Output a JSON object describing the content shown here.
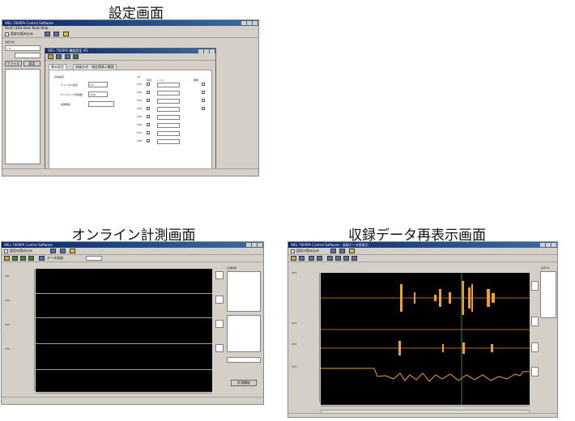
{
  "captions": {
    "settings": "設定画面",
    "online": "オンライン計測画面",
    "playback": "収録データ再表示画面"
  },
  "settings_window": {
    "app_title": "WEL-7000PA Control Software",
    "menu": "File(F)   Edit   View   Tools   Help",
    "toolbar_label": "設定の読み込み",
    "left_label": "測定方式",
    "left_value": "1 ch",
    "left_buttons": [
      "ファイル",
      "設定"
    ],
    "dialog_title": "WEL-7000PA 機能設定 #1",
    "tabs": [
      "基本設定",
      "収録方式・測定値表示範囲"
    ],
    "group_title": "基本設定",
    "form_labels": [
      "チャンネル設定",
      "サンプリング周波数",
      "記録時間"
    ],
    "form_values": [
      "1ch",
      "1kHz",
      ""
    ],
    "channel_header": [
      "CH",
      "有効",
      "レンジ",
      "備考"
    ],
    "channels": [
      "CH1",
      "CH2",
      "CH3",
      "CH4",
      "CH5",
      "CH6",
      "CH7",
      "CH8"
    ]
  },
  "online_window": {
    "app_title": "WEL-7000PA Control Software",
    "toolbar_label": "設定の読み込み",
    "toolbar_text": "データ収録",
    "channels": [
      "CH1",
      "CH2",
      "CH3",
      "CH4"
    ],
    "right_panel_title": "計測状態",
    "right_button": "計測開始"
  },
  "playback_window": {
    "app_title": "WEL-7000PA Control Software - 収録データ再表示",
    "toolbar_label": "設定の読み込み",
    "channels": [
      "CH1",
      "CH2",
      "CH3",
      "CH4"
    ],
    "right_panel_title": "表示CH"
  },
  "colors": {
    "title_bar": "#0a246a",
    "plot_bg": "#000000",
    "waveform": "#f0a030",
    "baseline": "#a3a37a",
    "window_bg": "#d4d0c8"
  }
}
